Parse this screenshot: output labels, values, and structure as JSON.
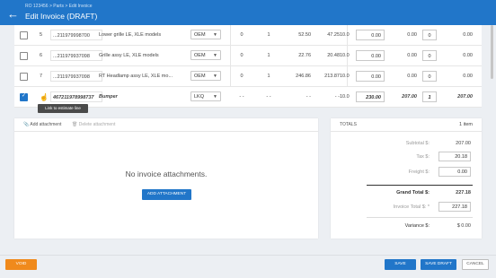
{
  "header": {
    "breadcrumb": "RO 123456 > Parts > Edit Invoice",
    "title": "Edit Invoice (DRAFT)",
    "back_icon": "arrow-left-icon"
  },
  "lines": [
    {
      "checked": false,
      "num": "5",
      "part": "...211979998700",
      "desc": "Lower grille LE, XLE models",
      "source": "OEM",
      "c1": "0",
      "c2": "1",
      "c3": "52.50",
      "c4": "47.25",
      "c5": "10.0",
      "price": "0.00",
      "total": "0.00",
      "qty": "0",
      "ext": "0.00",
      "bold": false
    },
    {
      "checked": false,
      "num": "6",
      "part": "...211979937098",
      "desc": "Grille assy LE, XLE models",
      "source": "OEM",
      "c1": "0",
      "c2": "1",
      "c3": "22.76",
      "c4": "20.48",
      "c5": "10.0",
      "price": "0.00",
      "total": "0.00",
      "qty": "0",
      "ext": "0.00",
      "bold": false
    },
    {
      "checked": false,
      "num": "7",
      "part": "...211979937098",
      "desc": "RT Headlamp assy LE, XLE mo...",
      "source": "OEM",
      "c1": "0",
      "c2": "1",
      "c3": "246.86",
      "c4": "213.87",
      "c5": "10.0",
      "price": "0.00",
      "total": "0.00",
      "qty": "0",
      "ext": "0.00",
      "bold": false
    },
    {
      "checked": true,
      "num": "",
      "part": "467211978998737",
      "desc": "Bumper",
      "source": "LKQ",
      "c1": "- -",
      "c2": "- -",
      "c3": "- -",
      "c4": "- -",
      "c5": "10.0",
      "price": "230.00",
      "total": "207.00",
      "qty": "1",
      "ext": "207.00",
      "bold": true
    }
  ],
  "tooltip": "Link to estimate line",
  "attachments": {
    "add_label": "Add attachment",
    "delete_label": "Delete attachment",
    "empty_text": "No invoice attachments.",
    "add_button": "ADD ATTACHMENT"
  },
  "totals": {
    "header": "TOTALS",
    "count": "1 item",
    "subtotal_label": "Subtotal $:",
    "subtotal": "207.00",
    "tax_label": "Tax $:",
    "tax": "20.18",
    "freight_label": "Freight $:",
    "freight": "0.00",
    "grand_label": "Grand Total $:",
    "grand": "227.18",
    "invoice_label": "Invoice Total $: *",
    "invoice": "227.18",
    "variance_label": "Variance $:",
    "variance": "$ 0.00"
  },
  "footer": {
    "void": "VOID",
    "save": "SAVE",
    "save_draft": "SAVE DRAFT",
    "cancel": "CANCEL"
  }
}
